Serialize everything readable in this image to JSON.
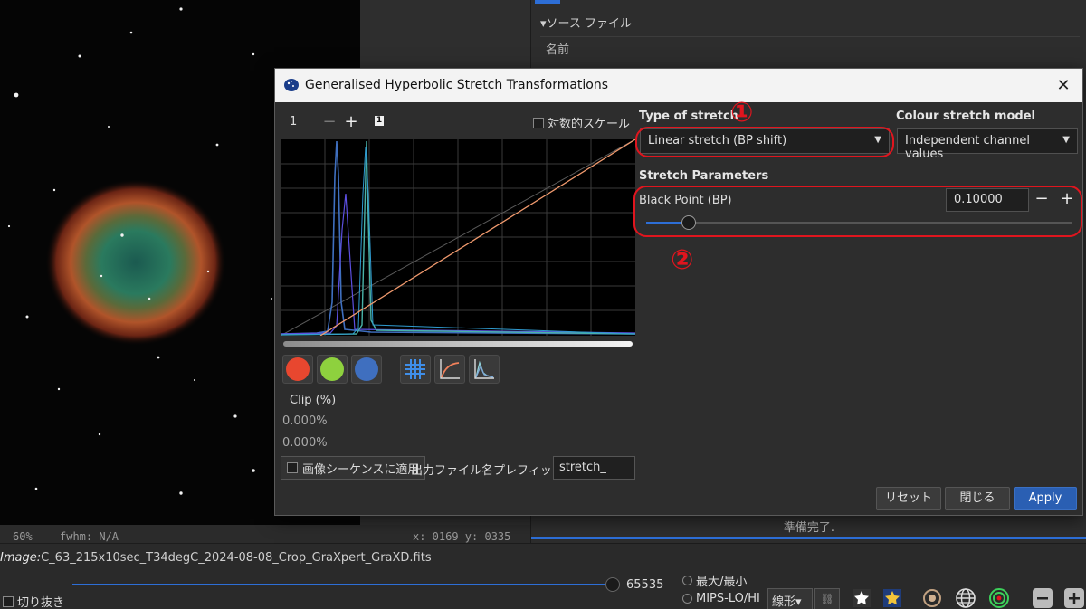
{
  "background": {
    "zoom_level": "60%",
    "fwhm": "fwhm: N/A",
    "cursor": "x: 0169 y: 0335",
    "source_files_title": "▾ソース ファイル",
    "name_header": "名前",
    "status": "準備完了.",
    "image_label": "Image:",
    "image_name": "C_63_215x10sec_T34degC_2024-08-08_Crop_GraXpert_GraXD.fits",
    "max_value": "65535",
    "radio_minmax": "最大/最小",
    "radio_mips": "MIPS-LO/HI",
    "scale_mode": "線形▾",
    "crop_label": "切り抜き"
  },
  "dialog": {
    "title": "Generalised Hyperbolic Stretch Transformations",
    "zoom_value": "1",
    "zoom_minus": "−",
    "zoom_plus": "+",
    "badge": "1",
    "log_scale_label": "対数的スケール",
    "clip_label": "Clip (%)",
    "clip_low": "0.000%",
    "clip_high": "0.000%",
    "apply_sequence_label": "画像シーケンスに適用",
    "prefix_label": "出力ファイル名プレフィックス:",
    "prefix_value": "stretch_",
    "type_of_stretch_label": "Type of stretch",
    "type_of_stretch_value": "Linear stretch (BP shift)",
    "colour_model_label": "Colour stretch model",
    "colour_model_value": "Independent channel values",
    "stretch_params_label": "Stretch Parameters",
    "black_point_label": "Black Point (BP)",
    "black_point_value": "0.10000",
    "black_point_fraction": 0.1,
    "reset_label": "リセット",
    "close_label": "閉じる",
    "apply_label": "Apply",
    "annotation_1": "①",
    "annotation_2": "②"
  },
  "colors": {
    "accent": "#2d6ed6",
    "annotation": "#e0151e",
    "red_channel": "#e8472f",
    "green_channel": "#8ed13e",
    "blue_channel": "#3f6fbf"
  }
}
